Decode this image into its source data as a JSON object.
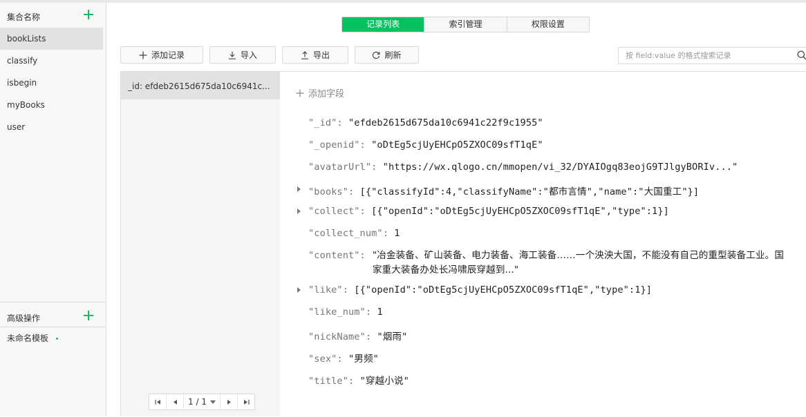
{
  "sidebar": {
    "header_title": "集合名称",
    "collections": [
      "bookLists",
      "classify",
      "isbegin",
      "myBooks",
      "user"
    ],
    "active_collection": "bookLists",
    "advanced_title": "高级操作",
    "template_name": "未命名模板"
  },
  "tabs": [
    {
      "label": "记录列表",
      "active": true
    },
    {
      "label": "索引管理",
      "active": false
    },
    {
      "label": "权限设置",
      "active": false
    }
  ],
  "toolbar": {
    "add_label": "添加记录",
    "import_label": "导入",
    "export_label": "导出",
    "refresh_label": "刷新"
  },
  "search": {
    "placeholder": "按 field:value 的格式搜索记录",
    "value": ""
  },
  "records": [
    {
      "label": "_id: efdeb2615d675da10c6941c..."
    }
  ],
  "pager": {
    "label": "1 / 1"
  },
  "detail": {
    "add_field_label": "添加字段",
    "fields": [
      {
        "key": "\"_id\":",
        "value": "\"efdeb2615d675da10c6941c22f9c1955\"",
        "expandable": false
      },
      {
        "key": "\"_openid\":",
        "value": "\"oDtEg5cjUyEHCpO5ZXOC09sfT1qE\"",
        "expandable": false
      },
      {
        "key": "\"avatarUrl\":",
        "value": "\"https://wx.qlogo.cn/mmopen/vi_32/DYAIOgq83eojG9TJlgyBORIv...\"",
        "expandable": false
      },
      {
        "key": "\"books\":",
        "value": "[{\"classifyId\":4,\"classifyName\":\"都市言情\",\"name\":\"大国重工\"}]",
        "expandable": true
      },
      {
        "key": "\"collect\":",
        "value": "[{\"openId\":\"oDtEg5cjUyEHCpO5ZXOC09sfT1qE\",\"type\":1}]",
        "expandable": true
      },
      {
        "key": "\"collect_num\":",
        "value": "1",
        "expandable": false
      },
      {
        "key": "\"content\":",
        "value": "\"冶金装备、矿山装备、电力装备、海工装备……一个泱泱大国，不能没有自己的重型装备工业。国家重大装备办处长冯啸辰穿越到...\"",
        "expandable": false
      },
      {
        "key": "\"like\":",
        "value": "[{\"openId\":\"oDtEg5cjUyEHCpO5ZXOC09sfT1qE\",\"type\":1}]",
        "expandable": true
      },
      {
        "key": "\"like_num\":",
        "value": "1",
        "expandable": false
      },
      {
        "key": "\"nickName\":",
        "value": "\"烟雨\"",
        "expandable": false
      },
      {
        "key": "\"sex\":",
        "value": "\"男频\"",
        "expandable": false
      },
      {
        "key": "\"title\":",
        "value": "\"穿越小说\"",
        "expandable": false
      }
    ]
  },
  "colors": {
    "accent": "#07c160",
    "sidebar_bg": "#f7f7f7",
    "selected_bg": "#e2e2e2"
  }
}
